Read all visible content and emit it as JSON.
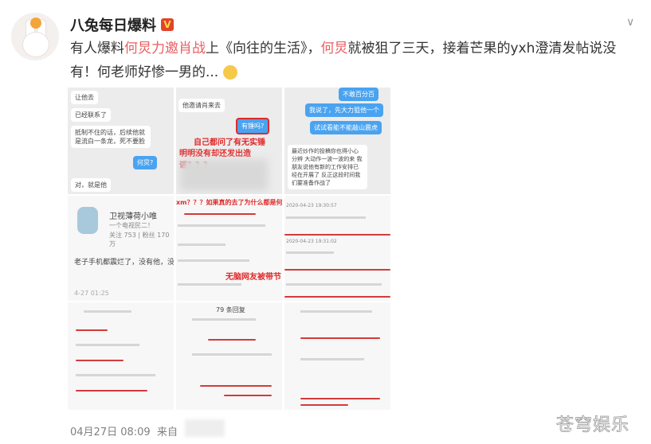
{
  "post": {
    "author": "八兔每日爆料",
    "verified_badge": "V",
    "text_parts": [
      "有人爆料",
      "何炅力邀肖战",
      "上《向往的生活》，",
      "何炅",
      "就被狙了三天，接着芒果的yxh澄清发帖说没有！何老师好惨一男的..."
    ],
    "timestamp": "04月27日 08:09",
    "source_prefix": "来自"
  },
  "images": {
    "c1": [
      "让他去",
      "已经联系了",
      "抵制不住的话，后续他就是流白一条龙，死不要脸",
      "何炅?",
      "对，就是他"
    ],
    "c2": [
      "他邀请肖来去",
      "有锤吗?",
      "自己都问了有无实锤",
      "明明没有却还发出造谣？？？"
    ],
    "c3": [
      "不敢百分百",
      "我说了，先大力狙他一个",
      "试试看能不能敲山震虎",
      "最近炒作的投稿你也得小心分辨 大动作一波一波的来 我朋友说他有新的工作安排已经在开展了 反正这段时间我们要准备作战了"
    ],
    "c4": [
      "卫视薄荷小唯",
      "一个电视民二！",
      "关注 753 | 粉丝 170万",
      "老子手机都震烂了，没有他，没",
      "4-27 01:25"
    ],
    "c5": [
      "xm？？？如果真的去了为什么都是何灵谴",
      "无脑网友被带节"
    ],
    "c6": [
      "2020-04-23 19:30:57",
      "2020-04-23 19:31:02"
    ],
    "c8": [
      "79 条回复"
    ]
  },
  "watermark": "苍穹娱乐"
}
